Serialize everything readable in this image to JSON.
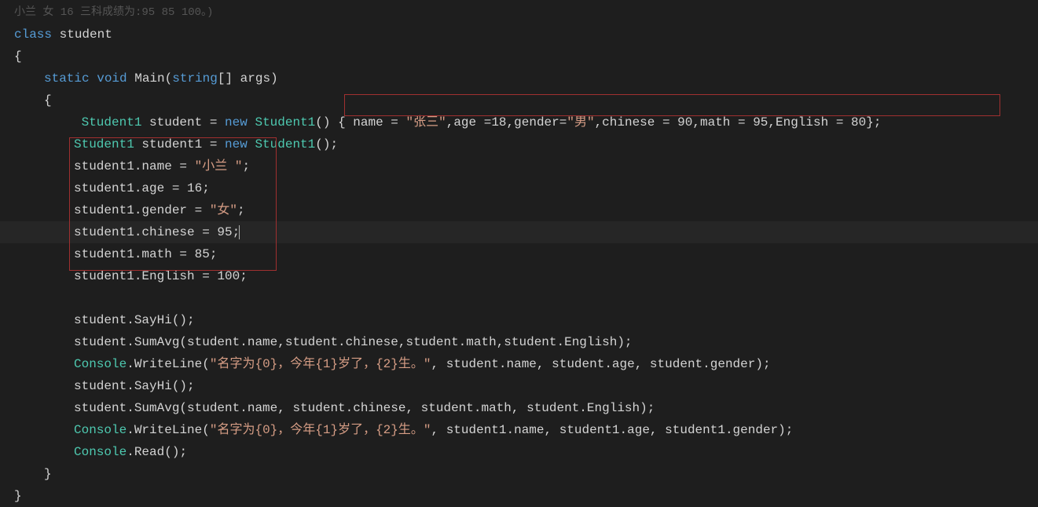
{
  "topComment": "小兰 女 16 三科成绩为:95 85 100。)",
  "lines": {
    "l1_kw1": "class",
    "l1_txt1": " student",
    "l2_txt": "{",
    "l3_kw1": "static",
    "l3_kw2": " void",
    "l3_method": " Main",
    "l3_txt1": "(",
    "l3_kw3": "string",
    "l3_txt2": "[] args)",
    "l4_txt": "{",
    "l5_type1": " Student1",
    "l5_txt1": " student = ",
    "l5_kw1": "new",
    "l5_type2": " Student1",
    "l5_txt2": "() { name = ",
    "l5_str1": "\"张三\"",
    "l5_txt3": ",age =18,gender=",
    "l5_str2": "\"男\"",
    "l5_txt4": ",chinese = 90,math = 95,English = 80};",
    "l6_type1": "Student1",
    "l6_txt1": " student1 = ",
    "l6_kw1": "new",
    "l6_type2": " Student1",
    "l6_txt2": "();",
    "l7_txt1": "student1.name = ",
    "l7_str1": "\"小兰 \"",
    "l7_txt2": ";",
    "l8_txt": "student1.age = 16;",
    "l9_txt1": "student1.gender = ",
    "l9_str1": "\"女\"",
    "l9_txt2": ";",
    "l10_txt": "student1.chinese = 95;",
    "l11_txt": "student1.math = 85;",
    "l12_txt": "student1.English = 100;",
    "l13_txt1": "student.",
    "l13_method": "SayHi",
    "l13_txt2": "();",
    "l14_txt1": "student.",
    "l14_method": "SumAvg",
    "l14_txt2": "(student.name,student.chinese,student.math,student.English);",
    "l15_type": "Console",
    "l15_txt1": ".",
    "l15_method": "WriteLine",
    "l15_txt2": "(",
    "l15_str": "\"名字为{0}，今年{1}岁了，{2}生。\"",
    "l15_txt3": ", student.name, student.age, student.gender);",
    "l16_txt1": "student.",
    "l16_method": "SayHi",
    "l16_txt2": "();",
    "l17_txt1": "student.",
    "l17_method": "SumAvg",
    "l17_txt2": "(student.name, student.chinese, student.math, student.English);",
    "l18_type": "Console",
    "l18_txt1": ".",
    "l18_method": "WriteLine",
    "l18_txt2": "(",
    "l18_str": "\"名字为{0}，今年{1}岁了，{2}生。\"",
    "l18_txt3": ", student1.name, student1.age, student1.gender);",
    "l19_type": "Console",
    "l19_txt1": ".",
    "l19_method": "Read",
    "l19_txt2": "();",
    "l20_txt": "}",
    "l21_txt": "}"
  }
}
